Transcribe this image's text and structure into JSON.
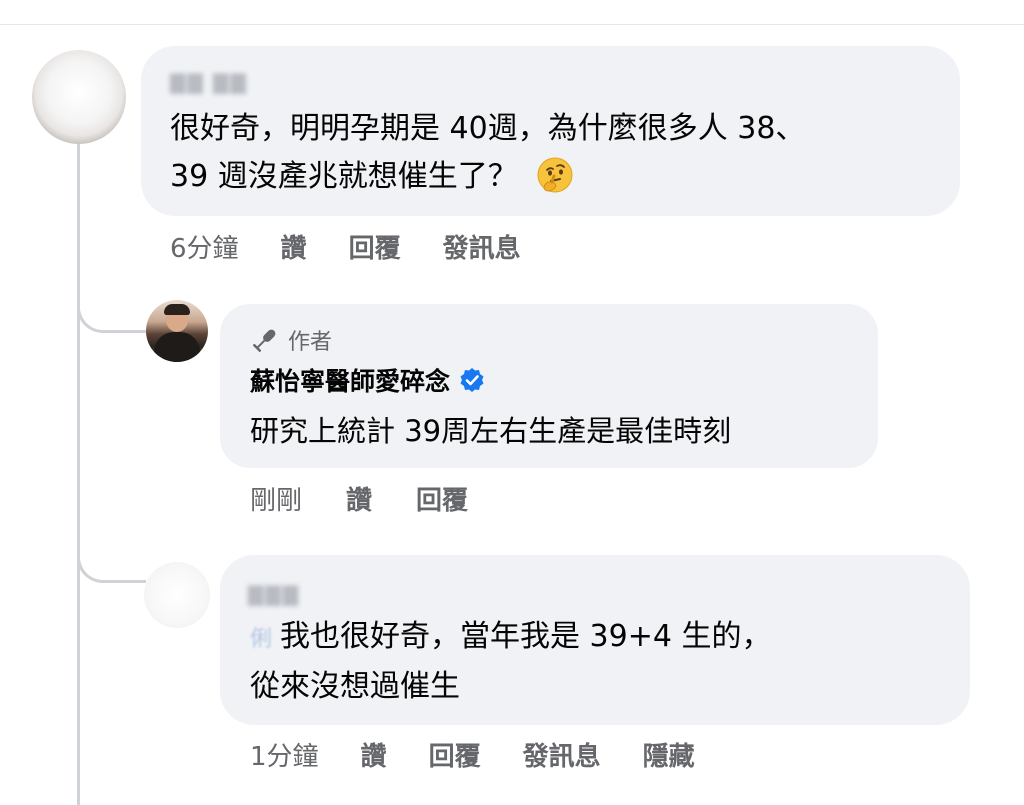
{
  "comments": [
    {
      "author": "",
      "text_line1": "很好奇，明明孕期是 40週，為什麼很多人 38、",
      "text_line2": "39 週沒產兆就想催生了？",
      "emoji": "thinking-face-icon",
      "actions": {
        "time": "6分鐘",
        "like": "讚",
        "reply": "回覆",
        "message": "發訊息"
      }
    },
    {
      "badge": "作者",
      "author": "蘇怡寧醫師愛碎念",
      "verified": true,
      "text": "研究上統計 39周左右生產是最佳時刻",
      "actions": {
        "time": "剛剛",
        "like": "讚",
        "reply": "回覆"
      }
    },
    {
      "author": "",
      "tag_fragment": "俐",
      "text_line1": "我也很好奇，當年我是 39+4 生的，",
      "text_line2": "從來沒想過催生",
      "actions": {
        "time": "1分鐘",
        "like": "讚",
        "reply": "回覆",
        "message": "發訊息",
        "hide": "隱藏"
      }
    }
  ],
  "colors": {
    "bubble": "#f0f2f5",
    "meta_text": "#65676b",
    "body_text": "#050505",
    "verified_blue": "#1877f2",
    "thread_line": "#cfd2d6"
  }
}
